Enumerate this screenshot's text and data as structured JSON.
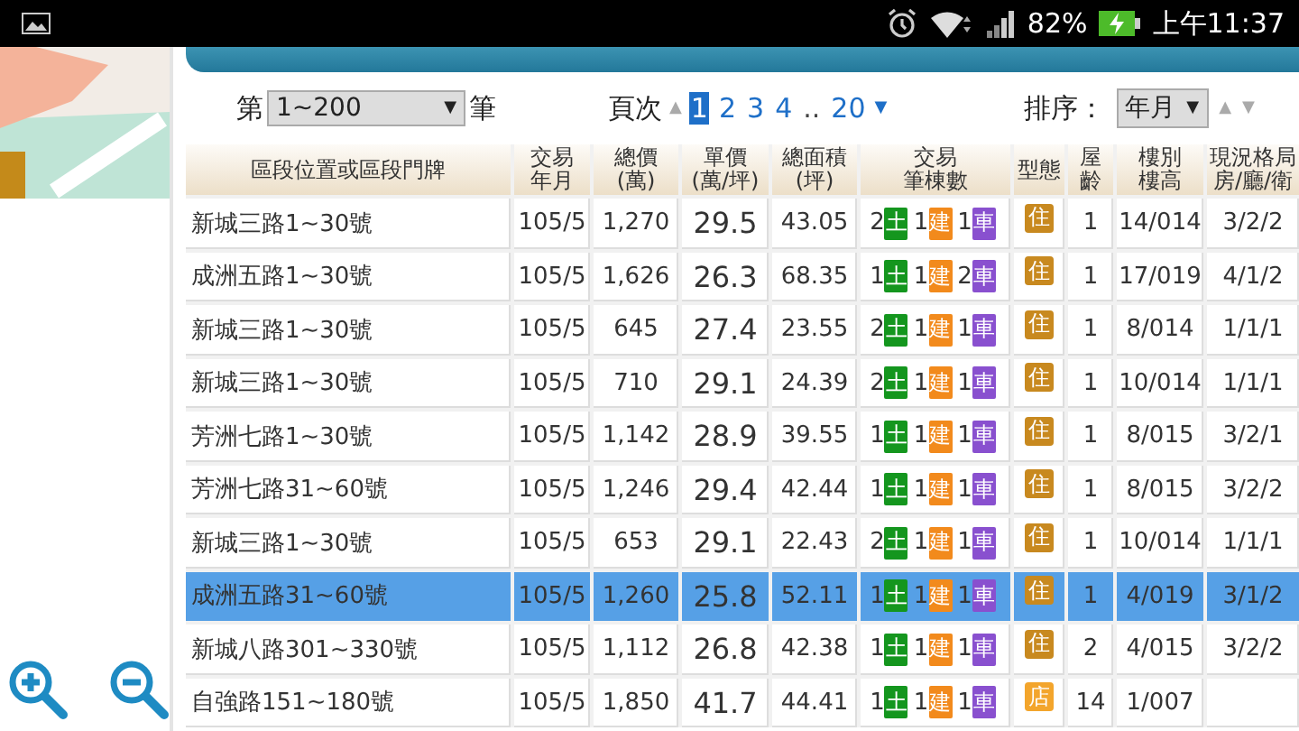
{
  "status_bar": {
    "battery": "82%",
    "time": "上午11:37"
  },
  "controls": {
    "range_prefix": "第",
    "range": "1~200",
    "range_suffix": "筆",
    "page_label": "頁次",
    "pages": [
      {
        "label": "1",
        "selected": true
      },
      {
        "label": "2",
        "selected": false
      },
      {
        "label": "3",
        "selected": false
      },
      {
        "label": "4",
        "selected": false
      }
    ],
    "ellipsis": "..",
    "last_page": "20",
    "sort_label": "排序：",
    "sort": "年月",
    "range_arrow": "▼",
    "prev_icon": "▲",
    "next_icon": "▼",
    "sort_arrow": "▼",
    "sort_up": "▲",
    "sort_down": "▼"
  },
  "table": {
    "columns": [
      [
        "區段位置或區段門牌"
      ],
      [
        "交易",
        "年月"
      ],
      [
        "總價",
        "(萬)"
      ],
      [
        "單價",
        "(萬/坪)"
      ],
      [
        "總面積",
        "(坪)"
      ],
      [
        "交易",
        "筆棟數"
      ],
      [
        "型態"
      ],
      [
        "屋",
        "齡"
      ],
      [
        "樓別",
        "樓高"
      ],
      [
        "現況格局",
        "房/廳/衛"
      ]
    ],
    "rows": [
      {
        "address": "新城三路1~30號",
        "date": "105/5",
        "total": "1,270",
        "unit": "29.5",
        "area": "43.05",
        "transaction": [
          {
            "kind": "land",
            "count": "2",
            "label": "土"
          },
          {
            "kind": "building",
            "count": "1",
            "label": "建"
          },
          {
            "kind": "parking",
            "count": "1",
            "label": "車"
          }
        ],
        "type": {
          "label": "住",
          "color": "#c8891f"
        },
        "age": "1",
        "floor": "14/014",
        "layout": "3/2/2",
        "selected": false
      },
      {
        "address": "成洲五路1~30號",
        "date": "105/5",
        "total": "1,626",
        "unit": "26.3",
        "area": "68.35",
        "transaction": [
          {
            "kind": "land",
            "count": "1",
            "label": "土"
          },
          {
            "kind": "building",
            "count": "1",
            "label": "建"
          },
          {
            "kind": "parking",
            "count": "2",
            "label": "車"
          }
        ],
        "type": {
          "label": "住",
          "color": "#c8891f"
        },
        "age": "1",
        "floor": "17/019",
        "layout": "4/1/2",
        "selected": false
      },
      {
        "address": "新城三路1~30號",
        "date": "105/5",
        "total": "645",
        "unit": "27.4",
        "area": "23.55",
        "transaction": [
          {
            "kind": "land",
            "count": "2",
            "label": "土"
          },
          {
            "kind": "building",
            "count": "1",
            "label": "建"
          },
          {
            "kind": "parking",
            "count": "1",
            "label": "車"
          }
        ],
        "type": {
          "label": "住",
          "color": "#c8891f"
        },
        "age": "1",
        "floor": "8/014",
        "layout": "1/1/1",
        "selected": false
      },
      {
        "address": "新城三路1~30號",
        "date": "105/5",
        "total": "710",
        "unit": "29.1",
        "area": "24.39",
        "transaction": [
          {
            "kind": "land",
            "count": "2",
            "label": "土"
          },
          {
            "kind": "building",
            "count": "1",
            "label": "建"
          },
          {
            "kind": "parking",
            "count": "1",
            "label": "車"
          }
        ],
        "type": {
          "label": "住",
          "color": "#c8891f"
        },
        "age": "1",
        "floor": "10/014",
        "layout": "1/1/1",
        "selected": false
      },
      {
        "address": "芳洲七路1~30號",
        "date": "105/5",
        "total": "1,142",
        "unit": "28.9",
        "area": "39.55",
        "transaction": [
          {
            "kind": "land",
            "count": "1",
            "label": "土"
          },
          {
            "kind": "building",
            "count": "1",
            "label": "建"
          },
          {
            "kind": "parking",
            "count": "1",
            "label": "車"
          }
        ],
        "type": {
          "label": "住",
          "color": "#c8891f"
        },
        "age": "1",
        "floor": "8/015",
        "layout": "3/2/1",
        "selected": false
      },
      {
        "address": "芳洲七路31~60號",
        "date": "105/5",
        "total": "1,246",
        "unit": "29.4",
        "area": "42.44",
        "transaction": [
          {
            "kind": "land",
            "count": "1",
            "label": "土"
          },
          {
            "kind": "building",
            "count": "1",
            "label": "建"
          },
          {
            "kind": "parking",
            "count": "1",
            "label": "車"
          }
        ],
        "type": {
          "label": "住",
          "color": "#c8891f"
        },
        "age": "1",
        "floor": "8/015",
        "layout": "3/2/2",
        "selected": false
      },
      {
        "address": "新城三路1~30號",
        "date": "105/5",
        "total": "653",
        "unit": "29.1",
        "area": "22.43",
        "transaction": [
          {
            "kind": "land",
            "count": "2",
            "label": "土"
          },
          {
            "kind": "building",
            "count": "1",
            "label": "建"
          },
          {
            "kind": "parking",
            "count": "1",
            "label": "車"
          }
        ],
        "type": {
          "label": "住",
          "color": "#c8891f"
        },
        "age": "1",
        "floor": "10/014",
        "layout": "1/1/1",
        "selected": false
      },
      {
        "address": "成洲五路31~60號",
        "date": "105/5",
        "total": "1,260",
        "unit": "25.8",
        "area": "52.11",
        "transaction": [
          {
            "kind": "land",
            "count": "1",
            "label": "土"
          },
          {
            "kind": "building",
            "count": "1",
            "label": "建"
          },
          {
            "kind": "parking",
            "count": "1",
            "label": "車"
          }
        ],
        "type": {
          "label": "住",
          "color": "#c8891f"
        },
        "age": "1",
        "floor": "4/019",
        "layout": "3/1/2",
        "selected": true
      },
      {
        "address": "新城八路301~330號",
        "date": "105/5",
        "total": "1,112",
        "unit": "26.8",
        "area": "42.38",
        "transaction": [
          {
            "kind": "land",
            "count": "1",
            "label": "土"
          },
          {
            "kind": "building",
            "count": "1",
            "label": "建"
          },
          {
            "kind": "parking",
            "count": "1",
            "label": "車"
          }
        ],
        "type": {
          "label": "住",
          "color": "#c8891f"
        },
        "age": "2",
        "floor": "4/015",
        "layout": "3/2/2",
        "selected": false
      },
      {
        "address": "自強路151~180號",
        "date": "105/5",
        "total": "1,850",
        "unit": "41.7",
        "area": "44.41",
        "transaction": [
          {
            "kind": "land",
            "count": "1",
            "label": "土"
          },
          {
            "kind": "building",
            "count": "1",
            "label": "建"
          },
          {
            "kind": "parking",
            "count": "1",
            "label": "車"
          }
        ],
        "type": {
          "label": "店",
          "color": "#f3a52c"
        },
        "age": "14",
        "floor": "1/007",
        "selected": false
      }
    ]
  }
}
